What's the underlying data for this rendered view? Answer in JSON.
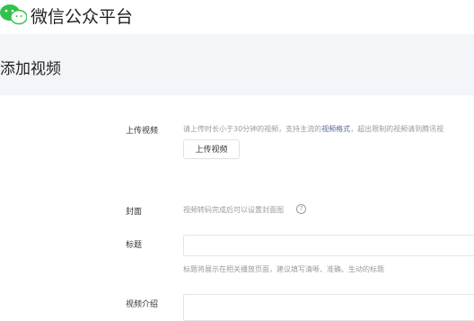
{
  "header": {
    "brand": "微信公众平台"
  },
  "page": {
    "title": "添加视频"
  },
  "form": {
    "upload": {
      "label": "上传视频",
      "hint_prefix": "请上传时长小于30分钟的视频，支持主流的",
      "hint_link": "视频格式",
      "hint_suffix": "，超出限制的视频请到腾讯视",
      "button": "上传视频"
    },
    "cover": {
      "label": "封面",
      "hint": "视频转码完成后可以设置封面图"
    },
    "title": {
      "label": "标题",
      "value": "",
      "hint": "标题将展示在相关播放页面，建议填写清晰、准确、生动的标题"
    },
    "intro": {
      "label": "视频介绍",
      "value": ""
    }
  },
  "colors": {
    "logo_green": "#32c24d",
    "link": "#576b95",
    "band": "#f4f5f9"
  }
}
